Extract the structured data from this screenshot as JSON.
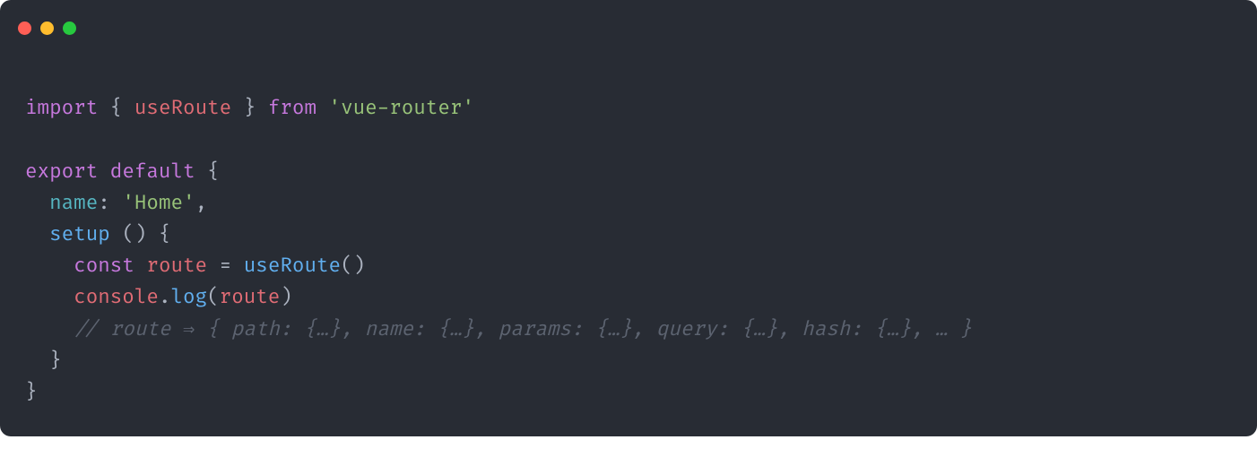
{
  "code": {
    "l1": {
      "kw1": "import",
      "brace_open": "{",
      "ident": "useRoute",
      "brace_close": "}",
      "kw2": "from",
      "str": "'vue-router'"
    },
    "l3": {
      "kw1": "export",
      "kw2": "default",
      "brace": "{"
    },
    "l4": {
      "prop": "name",
      "colon": ":",
      "str": "'Home'",
      "comma": ","
    },
    "l5": {
      "fn": "setup",
      "parens": "()",
      "brace": "{"
    },
    "l6": {
      "kw": "const",
      "ident": "route",
      "eq": "=",
      "call": "useRoute",
      "parens": "()"
    },
    "l7": {
      "obj": "console",
      "dot": ".",
      "method": "log",
      "open": "(",
      "arg": "route",
      "close": ")"
    },
    "l8": {
      "comment": "// route ⇒ { path: {…}, name: {…}, params: {…}, query: {…}, hash: {…}, … }"
    },
    "l9": {
      "brace": "}"
    },
    "l10": {
      "brace": "}"
    }
  }
}
